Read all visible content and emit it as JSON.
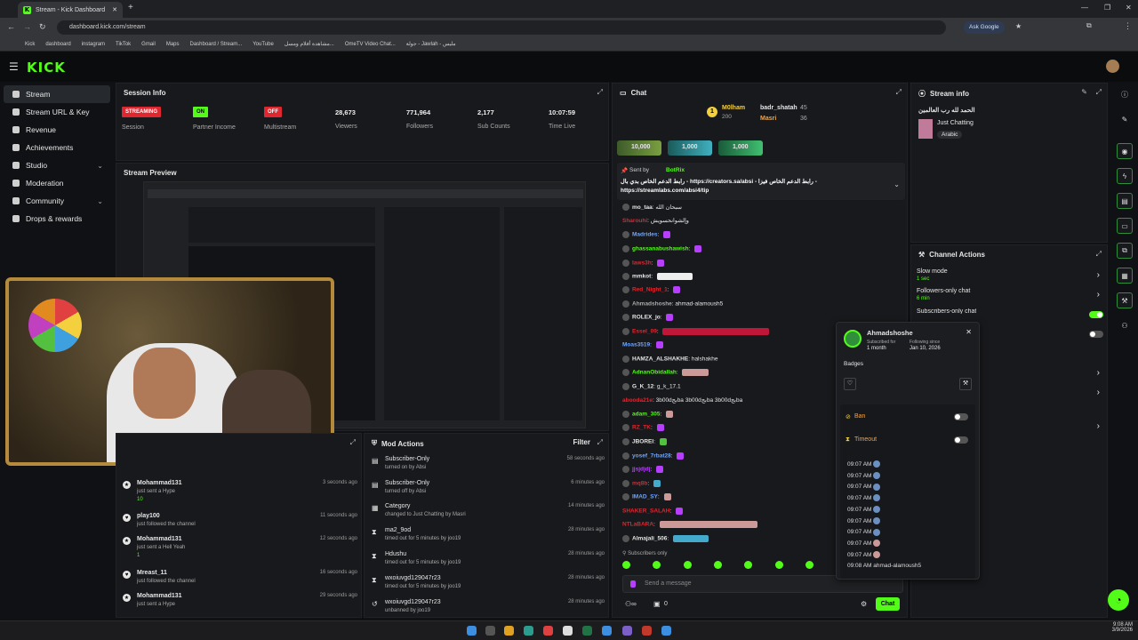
{
  "browser": {
    "tab_title": "Stream - Kick Dashboard",
    "url": "dashboard.kick.com/stream",
    "ask_google": "Ask Google",
    "bookmarks": [
      "Kick",
      "dashboard",
      "instagram",
      "TikTok",
      "Gmail",
      "Maps",
      "Dashboard / Stream...",
      "YouTube",
      "مشاهدة أفلام ومسل...",
      "OmeTV Video Chat...",
      "جولة - Jawlah - مليس"
    ]
  },
  "sidebar": {
    "items": [
      {
        "label": "Stream",
        "active": true
      },
      {
        "label": "Stream URL & Key"
      },
      {
        "label": "Revenue"
      },
      {
        "label": "Achievements"
      },
      {
        "label": "Studio",
        "chevron": true
      },
      {
        "label": "Moderation"
      },
      {
        "label": "Community",
        "chevron": true
      },
      {
        "label": "Drops & rewards"
      }
    ]
  },
  "session": {
    "title": "Session Info",
    "stats": [
      {
        "badge": "STREAMING",
        "badge_color": "#e0262f",
        "label": "Session"
      },
      {
        "badge": "ON",
        "badge_color": "#53fc18",
        "label": "Partner Income"
      },
      {
        "badge": "OFF",
        "badge_color": "#e0262f",
        "label": "Multistream"
      },
      {
        "value": "28,673",
        "label": "Viewers"
      },
      {
        "value": "771,964",
        "label": "Followers"
      },
      {
        "value": "2,177",
        "label": "Sub Counts"
      },
      {
        "value": "10:07:59",
        "label": "Time Live"
      }
    ]
  },
  "preview": {
    "title": "Stream Preview"
  },
  "feed": [
    {
      "name": "Mohammad131",
      "sub": "just sent a Hype",
      "count": "10",
      "time": "3 seconds ago"
    },
    {
      "name": "play100",
      "sub": "just followed the channel",
      "time": "11 seconds ago"
    },
    {
      "name": "Mohammad131",
      "sub": "just sent a Hell Yeah",
      "count": "1",
      "time": "12 seconds ago"
    },
    {
      "name": "Mreast_11",
      "sub": "just followed the channel",
      "time": "16 seconds ago"
    },
    {
      "name": "Mohammad131",
      "sub": "just sent a Hype",
      "time": "29 seconds ago"
    }
  ],
  "mod_actions": {
    "title": "Mod Actions",
    "filter": "Filter",
    "rows": [
      {
        "name": "Subscriber-Only",
        "sub": "turned on by Absi",
        "time": "58 seconds ago"
      },
      {
        "name": "Subscriber-Only",
        "sub": "turned off by Absi",
        "time": "6 minutes ago"
      },
      {
        "name": "Category",
        "sub": "changed to Just Chatting by Masri",
        "time": "14 minutes ago"
      },
      {
        "name": "ma2_9od",
        "sub": "timed out for 5 minutes by joo19",
        "time": "28 minutes ago"
      },
      {
        "name": "Hdushu",
        "sub": "timed out for 5 minutes by joo19",
        "time": "28 minutes ago"
      },
      {
        "name": "wxoiuvgd129047r23",
        "sub": "timed out for 5 minutes by joo19",
        "time": "28 minutes ago"
      },
      {
        "name": "wxoiuvgd129047r23",
        "sub": "unbanned by joo19",
        "time": "28 minutes ago"
      }
    ]
  },
  "chat": {
    "title": "Chat",
    "top_gifters": [
      {
        "name": "M0lham",
        "amount": "200"
      },
      {
        "name": "badr_shatah",
        "amount": "45"
      },
      {
        "name": "Masri",
        "amount": "36"
      }
    ],
    "gift_pills": [
      "10,000",
      "1,000",
      "1,000"
    ],
    "pinned_by": "Sent by",
    "pinned_user": "BotRix",
    "pinned_text": "رابط الدعم الخاص بدي بال - https://creators.sa/absi - رابط الدعم الخاص فيزا - https://streamlabs.com/absi4/tip",
    "messages": [
      {
        "user": "mo_taa",
        "color": "#e6e6e6",
        "text": "سبحان الله"
      },
      {
        "user": "Sharouhi",
        "color": "#e0262f",
        "text": "وإلشوانحسويش"
      },
      {
        "user": "Madrides",
        "color": "#6ea6ff",
        "text": ""
      },
      {
        "user": "ghassanabushawish",
        "color": "#53fc18",
        "text": ""
      },
      {
        "user": "Iaws3h",
        "color": "#e0262f",
        "text": ""
      },
      {
        "user": "mmkot",
        "color": "#e6e6e6",
        "text": ""
      },
      {
        "user": "Red_Night_1",
        "color": "#e0262f",
        "text": ""
      },
      {
        "user": "Ahmadshoshe",
        "color": "#aaa",
        "text": "ahmad-alamoush5"
      },
      {
        "user": "ROLEX_jo",
        "color": "#e6e6e6",
        "text": ""
      },
      {
        "user": "Essel_09",
        "color": "#e0262f",
        "text": ""
      },
      {
        "user": "Moas3519",
        "color": "#6ea6ff",
        "text": ""
      },
      {
        "user": "HAMZA_ALSHAKHE",
        "color": "#e6e6e6",
        "text": "halshakhe"
      },
      {
        "user": "AdnanObidallah",
        "color": "#53fc18",
        "text": ""
      },
      {
        "user": "G_K_12",
        "color": "#e6e6e6",
        "text": "g_k_17.1"
      },
      {
        "user": "abooda21e",
        "color": "#e0262f",
        "text": "3b00dبجba 3b00dبجba 3b00dبجba"
      },
      {
        "user": "adam_305",
        "color": "#53fc18",
        "text": ""
      },
      {
        "user": "RZ_TK",
        "color": "#e0262f",
        "text": ""
      },
      {
        "user": "JBOREI",
        "color": "#e6e6e6",
        "text": ""
      },
      {
        "user": "yosef_7rbat28",
        "color": "#6ea6ff",
        "text": ""
      },
      {
        "user": "jjsjdjdj",
        "color": "#b83eff",
        "text": ""
      },
      {
        "user": "mq8b",
        "color": "#e0262f",
        "text": ""
      },
      {
        "user": "IMAD_SY",
        "color": "#6ea6ff",
        "text": ""
      },
      {
        "user": "SHAKER_SALAH",
        "color": "#e0262f",
        "text": ""
      },
      {
        "user": "NTLaBARA",
        "color": "#e0262f",
        "text": ""
      },
      {
        "user": "Almajali_506",
        "color": "#e6e6e6",
        "text": ""
      }
    ],
    "subscribers_only": "Subscribers only",
    "input_placeholder": "Send a message",
    "send_label": "Chat",
    "footer_count": "0"
  },
  "user_card": {
    "name": "Ahmadshoshe",
    "subscribed_label": "Subscribed for",
    "subscribed_value": "1 month",
    "following_label": "Following since",
    "following_value": "Jan 10, 2026",
    "badges_label": "Badges",
    "ban_label": "Ban",
    "timeout_label": "Timeout",
    "log": [
      {
        "time": "09:07 AM",
        "text": ""
      },
      {
        "time": "09:07 AM",
        "text": ""
      },
      {
        "time": "09:07 AM",
        "text": ""
      },
      {
        "time": "09:07 AM",
        "text": ""
      },
      {
        "time": "09:07 AM",
        "text": ""
      },
      {
        "time": "09:07 AM",
        "text": ""
      },
      {
        "time": "09:07 AM",
        "text": ""
      },
      {
        "time": "09:07 AM",
        "text": ""
      },
      {
        "time": "09:07 AM",
        "text": ""
      },
      {
        "time": "09:08 AM",
        "text": "ahmad-alamoush5"
      }
    ]
  },
  "stream_info": {
    "title": "Stream info",
    "stream_title": "الحمد لله رب العالمين",
    "category": "Just Chatting",
    "tag": "Arabic"
  },
  "channel_actions": {
    "title": "Channel Actions",
    "rows": [
      {
        "label": "Slow mode",
        "value": "1 sec"
      },
      {
        "label": "Followers-only chat",
        "value": "6 min"
      },
      {
        "label": "Subscribers-only chat",
        "value": ""
      }
    ]
  },
  "taskbar": {
    "time": "9:08 AM",
    "date": "3/9/2026"
  }
}
